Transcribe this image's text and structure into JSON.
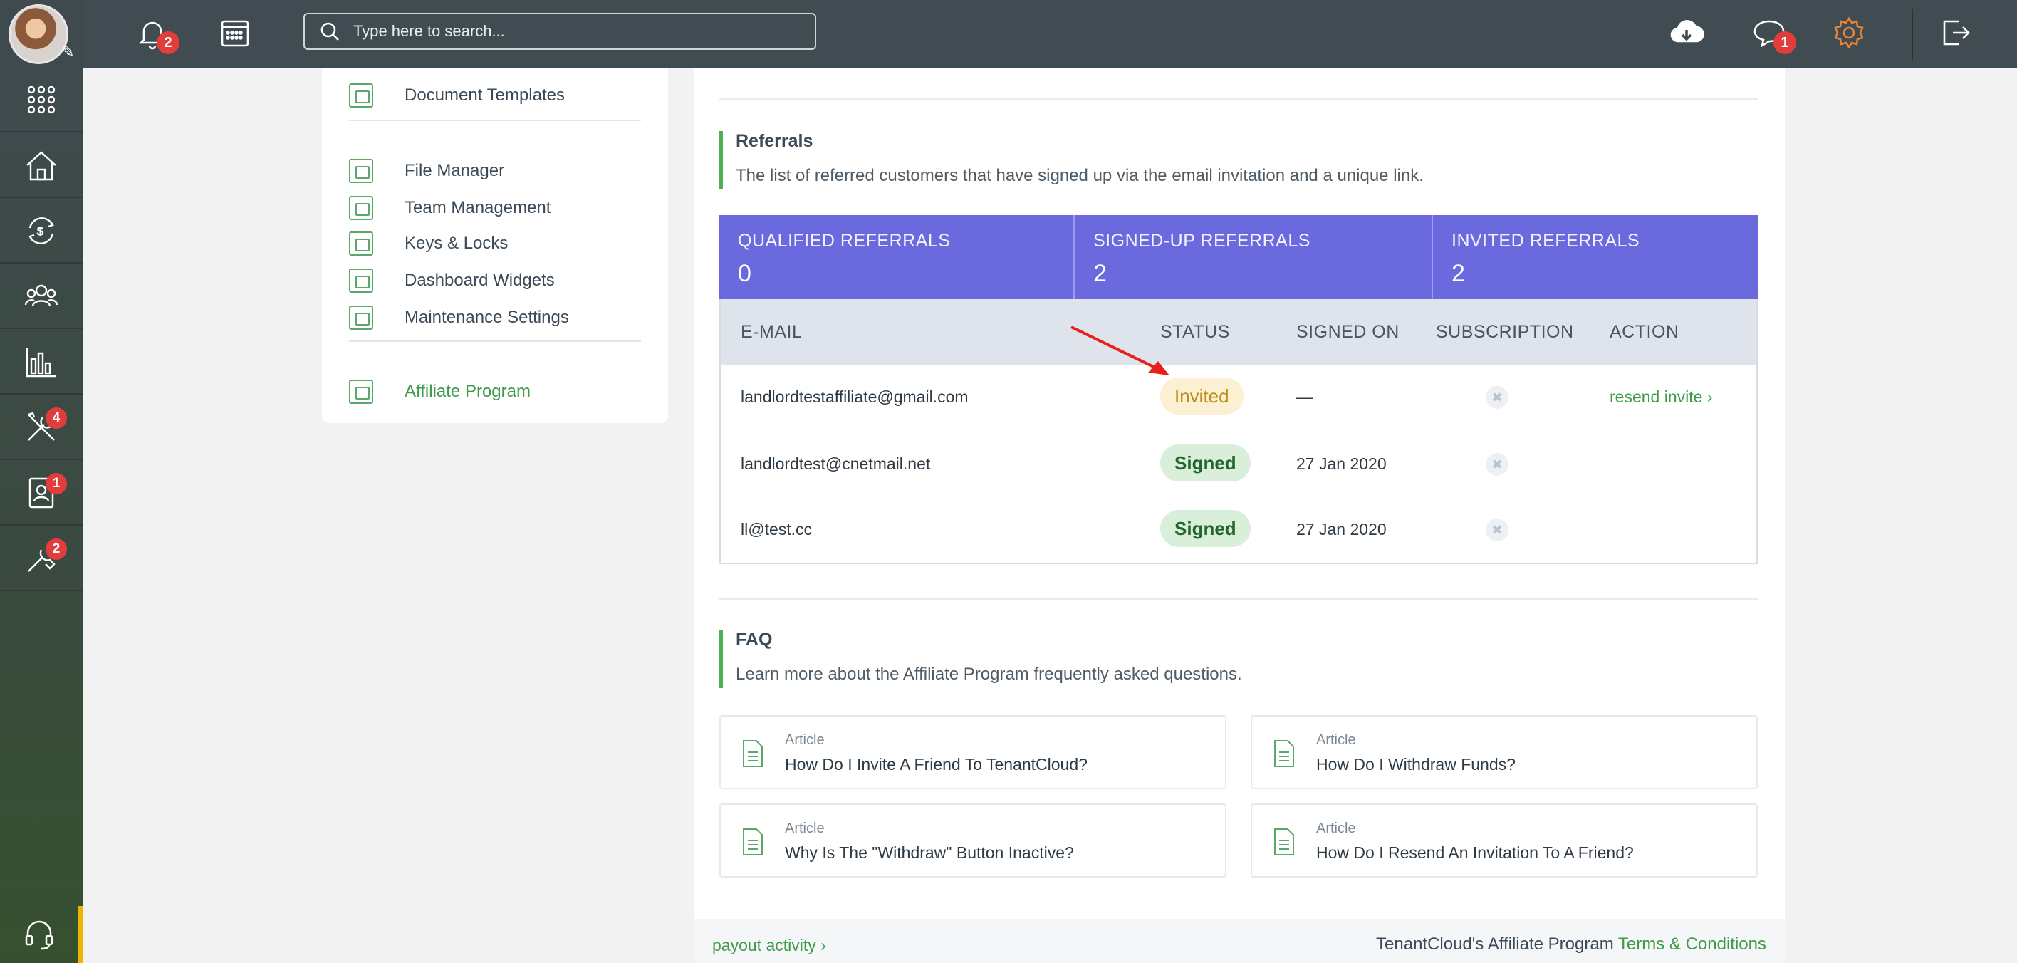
{
  "sidebar": {
    "badges": {
      "tools": "4",
      "tenants": "1",
      "integrations": "2"
    }
  },
  "topbar": {
    "notifications_badge": "2",
    "messages_badge": "1",
    "search_placeholder": "Type here to search..."
  },
  "settings_menu": {
    "items": [
      "Document Templates",
      "File Manager",
      "Team Management",
      "Keys & Locks",
      "Dashboard Widgets",
      "Maintenance Settings",
      "Affiliate Program"
    ]
  },
  "referrals": {
    "title": "Referrals",
    "description": "The list of referred customers that have signed up via the email invitation and a unique link.",
    "stats": [
      {
        "label": "QUALIFIED REFERRALS",
        "value": "0"
      },
      {
        "label": "SIGNED-UP REFERRALS",
        "value": "2"
      },
      {
        "label": "INVITED REFERRALS",
        "value": "2"
      }
    ],
    "columns": [
      "E-MAIL",
      "STATUS",
      "SIGNED ON",
      "SUBSCRIPTION",
      "ACTION"
    ],
    "rows": [
      {
        "email": "landlordtestaffiliate@gmail.com",
        "status": "Invited",
        "signed_on": "—",
        "action": "resend invite"
      },
      {
        "email": "landlordtest@cnetmail.net",
        "status": "Signed",
        "signed_on": "27 Jan 2020",
        "action": ""
      },
      {
        "email": "ll@test.cc",
        "status": "Signed",
        "signed_on": "27 Jan 2020",
        "action": ""
      }
    ]
  },
  "faq": {
    "title": "FAQ",
    "description": "Learn more about the Affiliate Program frequently asked questions.",
    "articles": [
      {
        "kind": "Article",
        "title": "How Do I Invite A Friend To TenantCloud?"
      },
      {
        "kind": "Article",
        "title": "How Do I Withdraw Funds?"
      },
      {
        "kind": "Article",
        "title": "Why Is The \"Withdraw\" Button Inactive?"
      },
      {
        "kind": "Article",
        "title": "How Do I Resend An Invitation To A Friend?"
      }
    ]
  },
  "footer": {
    "payout_link": "payout activity",
    "terms_prefix": "TenantCloud's Affiliate Program",
    "terms_link": "Terms & Conditions"
  },
  "colors": {
    "accent_green": "#3f9a4a",
    "stats_purple": "#6a69dd",
    "badge_red": "#e23c3c",
    "topbar": "#414c52"
  }
}
